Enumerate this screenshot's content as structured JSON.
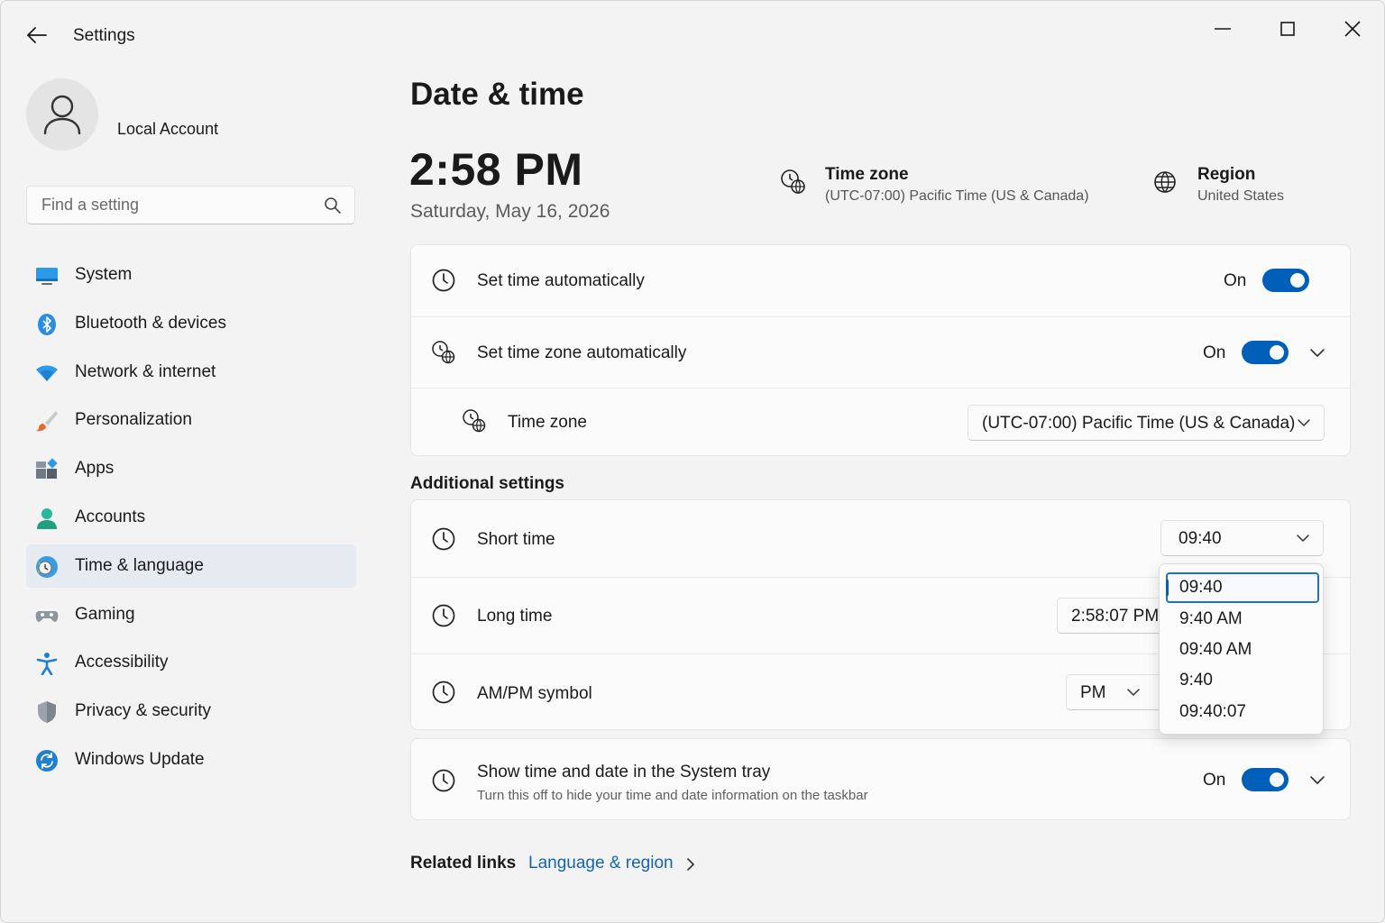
{
  "window": {
    "title": "Settings"
  },
  "account": {
    "name": "Local Account"
  },
  "search": {
    "placeholder": "Find a setting"
  },
  "sidebar": {
    "items": [
      {
        "label": "System",
        "icon": "system-icon"
      },
      {
        "label": "Bluetooth & devices",
        "icon": "bluetooth-icon"
      },
      {
        "label": "Network & internet",
        "icon": "wifi-icon"
      },
      {
        "label": "Personalization",
        "icon": "brush-icon"
      },
      {
        "label": "Apps",
        "icon": "apps-icon"
      },
      {
        "label": "Accounts",
        "icon": "person-icon"
      },
      {
        "label": "Time & language",
        "icon": "globe-clock-icon",
        "selected": true
      },
      {
        "label": "Gaming",
        "icon": "gamepad-icon"
      },
      {
        "label": "Accessibility",
        "icon": "accessibility-icon"
      },
      {
        "label": "Privacy & security",
        "icon": "shield-icon"
      },
      {
        "label": "Windows Update",
        "icon": "update-icon"
      }
    ]
  },
  "main": {
    "title": "Date & time",
    "clock": "2:58 PM",
    "date": "Saturday, May 16, 2026",
    "timezone_info": {
      "title": "Time zone",
      "value": "(UTC-07:00) Pacific Time (US & Canada)"
    },
    "region_info": {
      "title": "Region",
      "value": "United States"
    },
    "settings": {
      "set_time_auto": {
        "label": "Set time automatically",
        "state": "On"
      },
      "set_timezone_auto": {
        "label": "Set time zone automatically",
        "state": "On"
      },
      "time_zone": {
        "label": "Time zone",
        "value": "(UTC-07:00) Pacific Time (US & Canada)"
      }
    },
    "additional": {
      "heading": "Additional settings",
      "short_time": {
        "label": "Short time",
        "value": "09:40"
      },
      "long_time": {
        "label": "Long time",
        "value": "2:58:07 PM"
      },
      "ampm": {
        "label": "AM/PM symbol",
        "value": "PM"
      },
      "short_time_options": [
        "09:40",
        "9:40 AM",
        "09:40 AM",
        "9:40",
        "09:40:07"
      ],
      "tray": {
        "label": "Show time and date in the System tray",
        "description": "Turn this off to hide your time and date information on the taskbar",
        "state": "On"
      }
    },
    "related": {
      "label": "Related links",
      "link": "Language & region"
    }
  },
  "colors": {
    "accent": "#005fb8",
    "link": "#1464b4",
    "selected_nav": "#e6eaf1"
  }
}
